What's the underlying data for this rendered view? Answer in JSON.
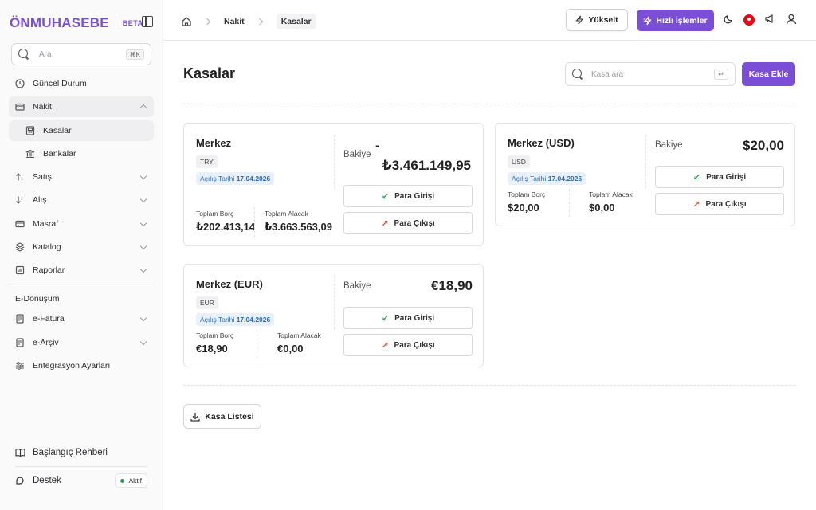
{
  "brand": {
    "logo": "ÖNMUHASEBE",
    "beta": "BETA"
  },
  "search": {
    "placeholder": "Ara",
    "shortcut": "⌘K"
  },
  "sidebar": {
    "items": [
      {
        "label": "Güncel Durum"
      },
      {
        "label": "Nakit"
      },
      {
        "label": "Kasalar"
      },
      {
        "label": "Bankalar"
      },
      {
        "label": "Satış"
      },
      {
        "label": "Alış"
      },
      {
        "label": "Masraf"
      },
      {
        "label": "Katalog"
      },
      {
        "label": "Raporlar"
      }
    ],
    "section": "E-Dönüşüm",
    "section_items": [
      {
        "label": "e-Fatura"
      },
      {
        "label": "e-Arşiv"
      },
      {
        "label": "Entegrasyon Ayarları"
      }
    ],
    "bottom": {
      "guide": "Başlangıç Rehberi",
      "support": "Destek",
      "status": "Aktif"
    }
  },
  "topbar": {
    "breadcrumb": [
      "Nakit",
      "Kasalar"
    ],
    "upgrade": "Yükselt",
    "quick_actions": "Hızlı İşlemler"
  },
  "page": {
    "title": "Kasalar",
    "search_placeholder": "Kasa ara",
    "add_button": "Kasa Ekle",
    "list_button": "Kasa Listesi"
  },
  "labels": {
    "opening_date": "Açılış Tarihi",
    "total_debt": "Toplam Borç",
    "total_credit": "Toplam Alacak",
    "balance": "Bakiye",
    "cash_in": "Para Girişi",
    "cash_out": "Para Çıkışı"
  },
  "cards": [
    {
      "name": "Merkez",
      "currency": "TRY",
      "opening_date": "17.04.2026",
      "total_debt": "₺202.413,14",
      "total_credit": "₺3.663.563,09",
      "balance_sign": "-",
      "balance": "₺3.461.149,95"
    },
    {
      "name": "Merkez (USD)",
      "currency": "USD",
      "opening_date": "17.04.2026",
      "total_debt": "$20,00",
      "total_credit": "$0,00",
      "balance": "$20,00"
    },
    {
      "name": "Merkez (EUR)",
      "currency": "EUR",
      "opening_date": "17.04.2026",
      "total_debt": "€18,90",
      "total_credit": "€0,00",
      "balance": "€18,90"
    }
  ],
  "colors": {
    "accent": "#7a4fd6",
    "in": "#2e9d4f",
    "out": "#e0522b"
  }
}
